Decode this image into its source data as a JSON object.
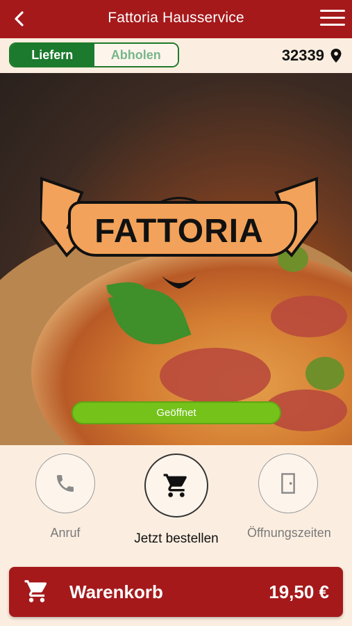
{
  "header": {
    "title": "Fattoria Hausservice",
    "back_icon": "chevron-left-icon",
    "menu_icon": "hamburger-menu-icon"
  },
  "order_mode": {
    "options": [
      "Liefern",
      "Abholen"
    ],
    "selected": "Liefern"
  },
  "location": {
    "zip": "32339",
    "icon": "map-pin-icon"
  },
  "hero": {
    "logo_text": "FATTORIA",
    "status": "Geöffnet"
  },
  "actions": [
    {
      "label": "Anruf",
      "icon": "phone-icon"
    },
    {
      "label": "Jetzt bestellen",
      "icon": "cart-icon"
    },
    {
      "label": "Öffnungszeiten",
      "icon": "door-icon"
    }
  ],
  "cart": {
    "label": "Warenkorb",
    "total": "19,50 €",
    "icon": "cart-icon"
  },
  "colors": {
    "brand": "#a5191b",
    "toggle_active": "#1b7a2d",
    "status_open": "#74c21a",
    "background": "#fbeee0"
  }
}
